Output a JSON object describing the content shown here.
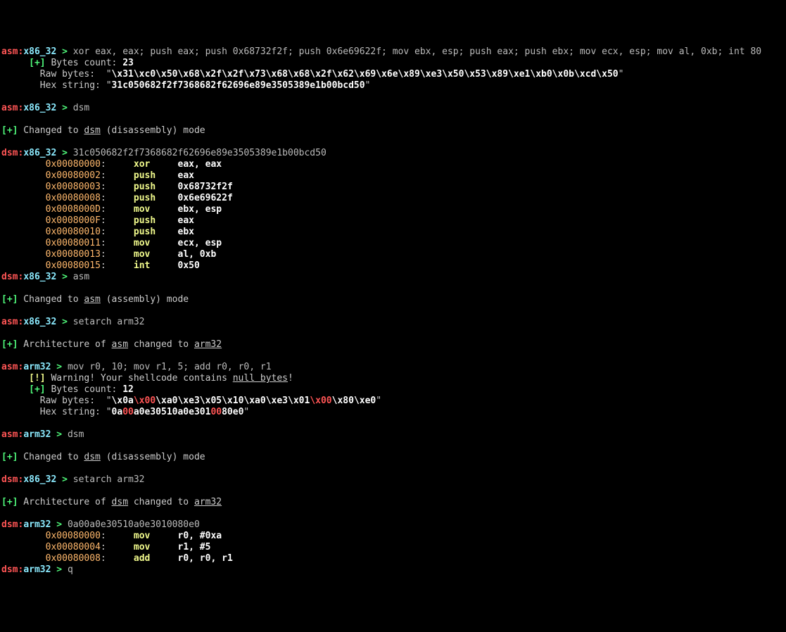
{
  "l1_mode": "asm",
  "l1_arch": "x86_32",
  "l1_gt": ">",
  "l1_cmd": "xor eax, eax; push eax; push 0x68732f2f; push 0x6e69622f; mov ebx, esp; push eax; push ebx; mov ecx, esp; mov al, 0xb; int 80",
  "l2_pre": "     ",
  "l2_plus": "[+]",
  "l2_lbl": " Bytes count: ",
  "l2_val": "23",
  "l3_pre": "       Raw bytes:  \"",
  "l3_val": "\\x31\\xc0\\x50\\x68\\x2f\\x2f\\x73\\x68\\x68\\x2f\\x62\\x69\\x6e\\x89\\xe3\\x50\\x53\\x89\\xe1\\xb0\\x0b\\xcd\\x50",
  "l3_q": "\"",
  "l4_pre": "       Hex string: \"",
  "l4_val": "31c050682f2f7368682f62696e89e3505389e1b00bcd50",
  "l4_q": "\"",
  "blank": "",
  "l6_mode": "asm",
  "l6_arch": "x86_32",
  "l6_gt": ">",
  "l6_cmd": "dsm",
  "l8_plus": "[+]",
  "l8_a": " Changed to ",
  "l8_b": "dsm",
  "l8_c": " (disassembly) mode",
  "l10_mode": "dsm",
  "l10_arch": "x86_32",
  "l10_gt": ">",
  "l10_cmd": "31c050682f2f7368682f62696e89e3505389e1b00bcd50",
  "dA": [
    {
      "addr": "0x00080000",
      "mn": "xor",
      "op": "eax, eax"
    },
    {
      "addr": "0x00080002",
      "mn": "push",
      "op": "eax"
    },
    {
      "addr": "0x00080003",
      "mn": "push",
      "op": "0x68732f2f"
    },
    {
      "addr": "0x00080008",
      "mn": "push",
      "op": "0x6e69622f"
    },
    {
      "addr": "0x0008000D",
      "mn": "mov",
      "op": "ebx, esp"
    },
    {
      "addr": "0x0008000F",
      "mn": "push",
      "op": "eax"
    },
    {
      "addr": "0x00080010",
      "mn": "push",
      "op": "ebx"
    },
    {
      "addr": "0x00080011",
      "mn": "mov",
      "op": "ecx, esp"
    },
    {
      "addr": "0x00080013",
      "mn": "mov",
      "op": "al, 0xb"
    },
    {
      "addr": "0x00080015",
      "mn": "int",
      "op": "0x50"
    }
  ],
  "sp8": "        ",
  "l21_mode": "dsm",
  "l21_arch": "x86_32",
  "l21_gt": ">",
  "l21_cmd": "asm",
  "l23_plus": "[+]",
  "l23_a": " Changed to ",
  "l23_b": "asm",
  "l23_c": " (assembly) mode",
  "l25_mode": "asm",
  "l25_arch": "x86_32",
  "l25_gt": ">",
  "l25_cmd": "setarch arm32",
  "l27_plus": "[+]",
  "l27_a": " Architecture of ",
  "l27_b": "asm",
  "l27_c": " changed to ",
  "l27_d": "arm32",
  "l29_mode": "asm",
  "l29_arch": "arm32",
  "l29_gt": ">",
  "l29_cmd": "mov r0, 10; mov r1, 5; add r0, r0, r1",
  "l30_pre": "     ",
  "l30_ex": "[!]",
  "l30_a": " Warning! Your shellcode contains ",
  "l30_b": "null bytes",
  "l30_c": "!",
  "l31_pre": "     ",
  "l31_plus": "[+]",
  "l31_lbl": " Bytes count: ",
  "l31_val": "12",
  "l32_pre": "       Raw bytes:  \"",
  "l32_a": "\\x0a",
  "l32_b": "\\x00",
  "l32_c": "\\xa0\\xe3\\x05\\x10\\xa0\\xe3\\x01",
  "l32_d": "\\x00",
  "l32_e": "\\x80\\xe0",
  "l32_q": "\"",
  "l33_pre": "       Hex string: \"",
  "l33_a": "0a",
  "l33_b": "00",
  "l33_c": "a0e30510a0e301",
  "l33_d": "00",
  "l33_e": "80e0",
  "l33_q": "\"",
  "l35_mode": "asm",
  "l35_arch": "arm32",
  "l35_gt": ">",
  "l35_cmd": "dsm",
  "l37_plus": "[+]",
  "l37_a": " Changed to ",
  "l37_b": "dsm",
  "l37_c": " (disassembly) mode",
  "l39_mode": "dsm",
  "l39_arch": "x86_32",
  "l39_gt": ">",
  "l39_cmd": "setarch arm32",
  "l41_plus": "[+]",
  "l41_a": " Architecture of ",
  "l41_b": "dsm",
  "l41_c": " changed to ",
  "l41_d": "arm32",
  "l43_mode": "dsm",
  "l43_arch": "arm32",
  "l43_gt": ">",
  "l43_cmd": "0a00a0e30510a0e3010080e0",
  "dB": [
    {
      "addr": "0x00080000",
      "mn": "mov",
      "op": "r0, #0xa"
    },
    {
      "addr": "0x00080004",
      "mn": "mov",
      "op": "r1, #5"
    },
    {
      "addr": "0x00080008",
      "mn": "add",
      "op": "r0, r0, r1"
    }
  ],
  "l47_mode": "dsm",
  "l47_arch": "arm32",
  "l47_gt": ">",
  "l47_cmd": "q"
}
